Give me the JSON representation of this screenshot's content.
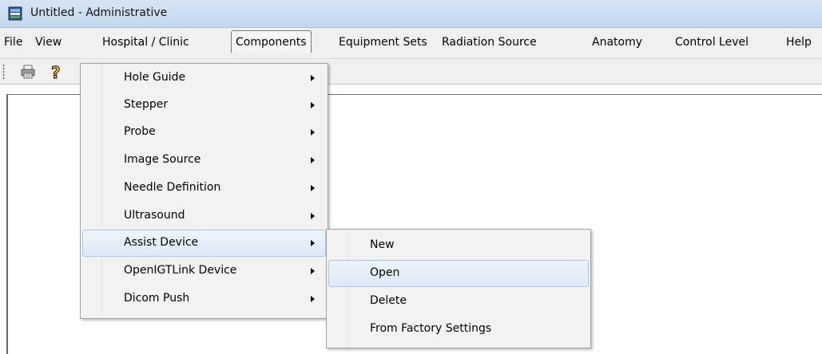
{
  "window": {
    "title": "Untitled - Administrative"
  },
  "menubar": {
    "items": [
      {
        "label": "File"
      },
      {
        "label": "View"
      },
      {
        "label": "Hospital / Clinic"
      },
      {
        "label": "Components"
      },
      {
        "label": "Equipment Sets"
      },
      {
        "label": "Radiation Source"
      },
      {
        "label": "Anatomy"
      },
      {
        "label": "Control Level"
      },
      {
        "label": "Help"
      }
    ]
  },
  "toolbar": {
    "icons": [
      "print-icon",
      "help-icon"
    ]
  },
  "components_menu": {
    "items": [
      {
        "label": "Hole Guide"
      },
      {
        "label": "Stepper"
      },
      {
        "label": "Probe"
      },
      {
        "label": "Image Source"
      },
      {
        "label": "Needle Definition"
      },
      {
        "label": "Ultrasound"
      },
      {
        "label": "Assist Device"
      },
      {
        "label": "OpenIGTLink Device"
      },
      {
        "label": "Dicom Push"
      }
    ]
  },
  "assist_device_submenu": {
    "items": [
      {
        "label": "New"
      },
      {
        "label": "Open"
      },
      {
        "label": "Delete"
      },
      {
        "label": "From Factory Settings"
      }
    ]
  },
  "colors": {
    "highlight": "#dce8f8",
    "highlight_border": "#a8c6ec",
    "menubar_bg": "#f0f0f0"
  }
}
